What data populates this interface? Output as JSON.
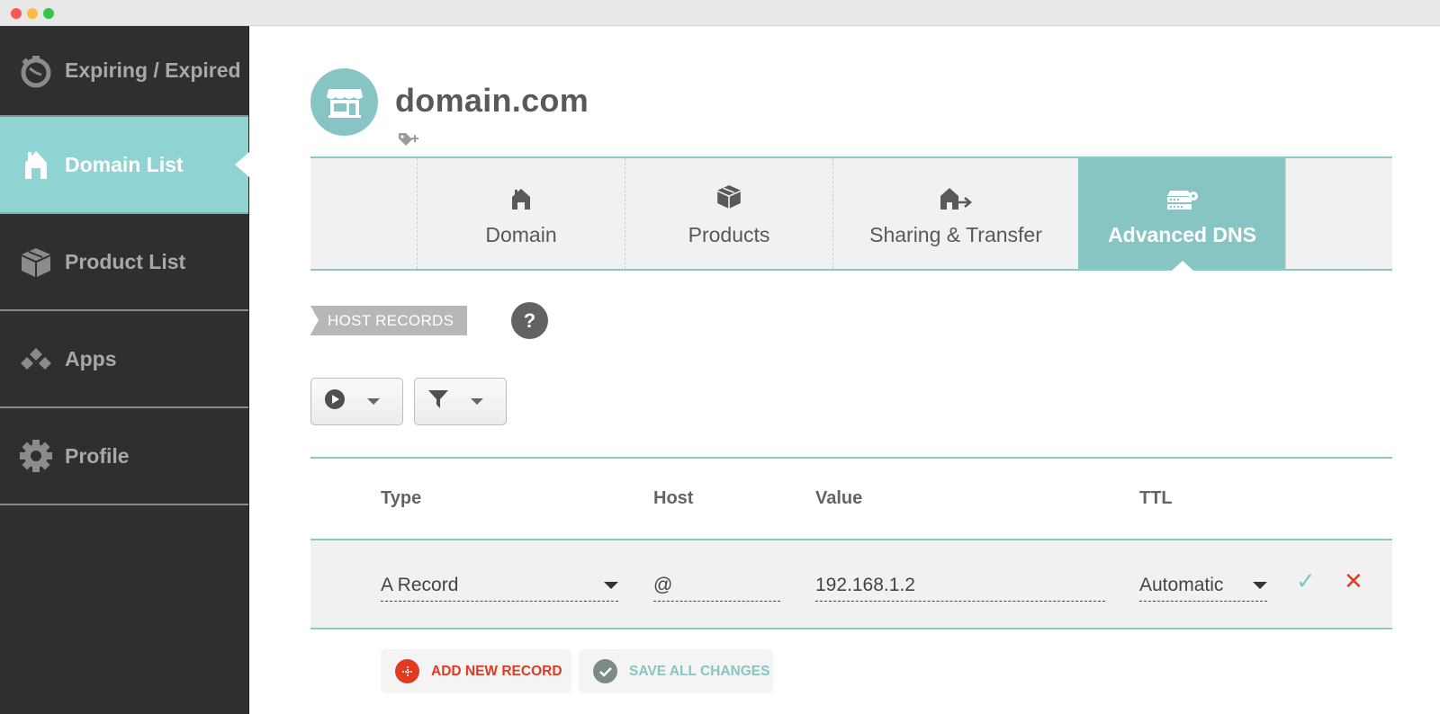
{
  "window": {
    "controls": [
      "close",
      "minimize",
      "zoom"
    ]
  },
  "sidebar": {
    "items": [
      {
        "label": "Expiring / Expired",
        "icon": "stopwatch-icon",
        "active": false
      },
      {
        "label": "Domain List",
        "icon": "house-icon",
        "active": true
      },
      {
        "label": "Product List",
        "icon": "box-icon",
        "active": false
      },
      {
        "label": "Apps",
        "icon": "apps-diamonds-icon",
        "active": false
      },
      {
        "label": "Profile",
        "icon": "gear-icon",
        "active": false
      }
    ]
  },
  "header": {
    "domain_name": "domain.com",
    "avatar_icon": "storefront-icon",
    "tag_icon": "add-tag-icon"
  },
  "tabs": [
    {
      "label": "Domain",
      "icon": "house-icon",
      "active": false
    },
    {
      "label": "Products",
      "icon": "box-icon",
      "active": false
    },
    {
      "label": "Sharing & Transfer",
      "icon": "house-transfer-icon",
      "active": false
    },
    {
      "label": "Advanced DNS",
      "icon": "server-gear-icon",
      "active": true
    }
  ],
  "section": {
    "label": "HOST RECORDS",
    "help_label": "?"
  },
  "toolbar": {
    "actions_icon": "play-circle-icon",
    "filter_icon": "filter-icon"
  },
  "table": {
    "columns": [
      "Type",
      "Host",
      "Value",
      "TTL"
    ],
    "rows": [
      {
        "type": "A Record",
        "host": "@",
        "value": "192.168.1.2",
        "ttl": "Automatic"
      }
    ]
  },
  "buttons": {
    "add_record": "ADD NEW RECORD",
    "save_changes": "SAVE ALL CHANGES"
  },
  "colors": {
    "accent_teal": "#86c5c4",
    "sidebar_active": "#8fd3d2",
    "sidebar_bg": "#2e2f31",
    "danger_red": "#e13a22"
  }
}
